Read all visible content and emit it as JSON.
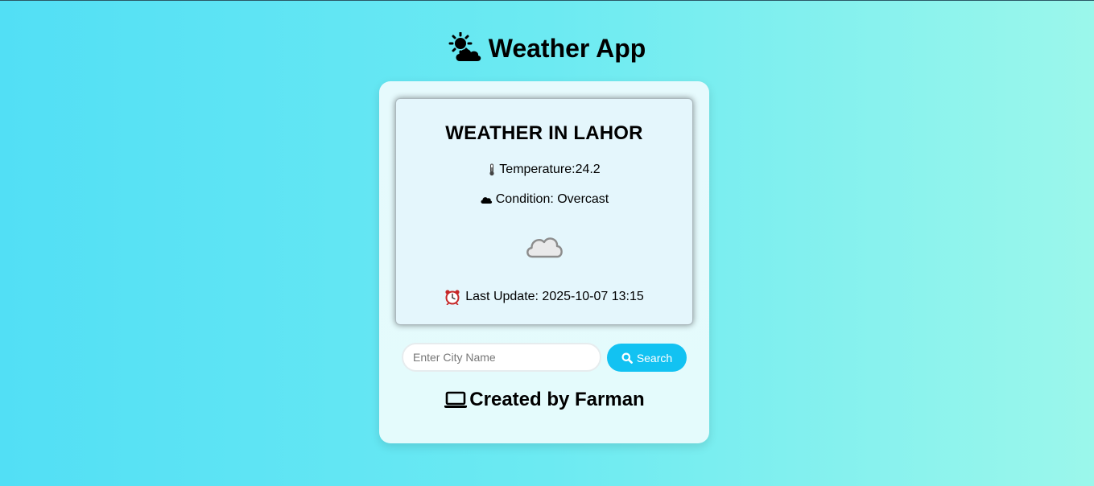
{
  "app": {
    "title": "Weather App",
    "title_icon": "sun-behind-cloud-icon"
  },
  "card": {
    "heading": "WEATHER IN LAHOR",
    "temperature_text": "Temperature:24.2",
    "temperature_icon": "thermometer-icon",
    "condition_text": "Condition: Overcast",
    "condition_icon": "cloud-icon",
    "weather_image_icon": "overcast-cloud-icon",
    "last_update_text": "Last Update: 2025-10-07 13:15",
    "last_update_icon": "alarm-clock-icon"
  },
  "search": {
    "placeholder": "Enter City Name",
    "value": "",
    "button_label": "Search",
    "button_icon": "search-icon"
  },
  "footer": {
    "text": "Created by Farman",
    "icon": "laptop-icon"
  },
  "colors": {
    "accent": "#12c2f2",
    "background_start": "#52dff5",
    "background_end": "#9bf7eb"
  }
}
